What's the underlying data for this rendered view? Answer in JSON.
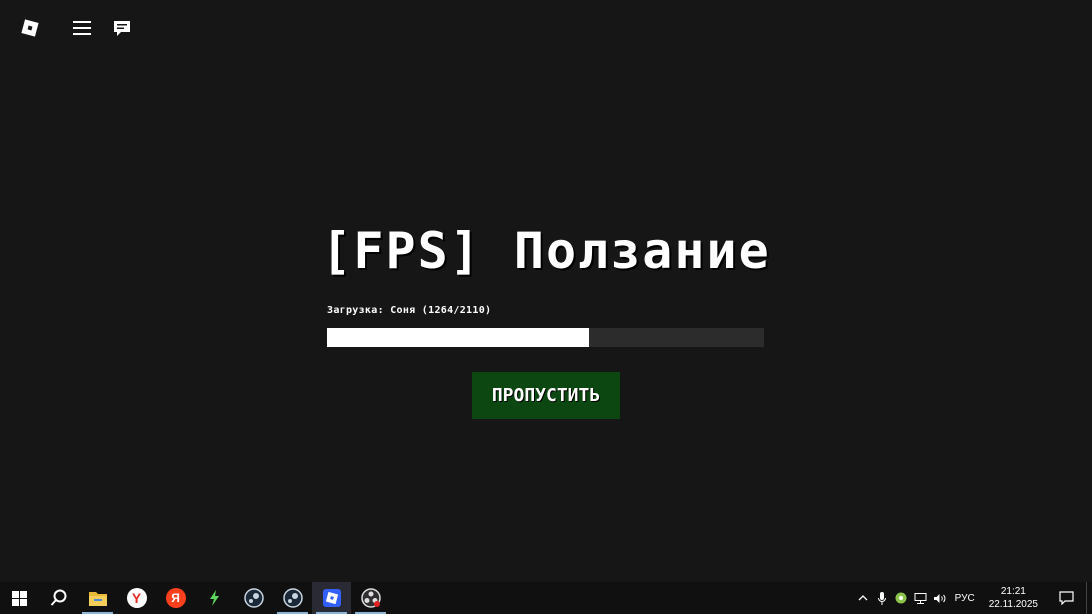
{
  "game": {
    "title": "[FPS] Ползание",
    "loading_text": "Загрузка: Соня (1264/2110)",
    "progress": 0.6,
    "skip_label": "ПРОПУСТИТЬ"
  },
  "top_controls": [
    {
      "name": "roblox-logo-button",
      "icon": "roblox-logo-icon"
    },
    {
      "name": "menu-button",
      "icon": "hamburger-menu-icon"
    },
    {
      "name": "chat-button",
      "icon": "chat-icon"
    }
  ],
  "taskbar": {
    "apps": [
      {
        "name": "start-button",
        "icon": "windows-logo-icon"
      },
      {
        "name": "search-button",
        "icon": "search-icon"
      },
      {
        "name": "file-explorer",
        "icon": "folder-icon"
      },
      {
        "name": "yandex-browser",
        "icon": "yandex-browser-icon"
      },
      {
        "name": "yandex",
        "icon": "yandex-icon"
      },
      {
        "name": "green-app",
        "icon": "lightning-icon"
      },
      {
        "name": "steam-1",
        "icon": "steam-icon"
      },
      {
        "name": "steam-2",
        "icon": "steam-icon"
      },
      {
        "name": "roblox",
        "icon": "roblox-icon"
      },
      {
        "name": "obs",
        "icon": "obs-icon"
      }
    ],
    "tray": {
      "language": "РУС",
      "time": "21:21",
      "date": "22.11.2025"
    }
  },
  "colors": {
    "background": "#161616",
    "progress_fill": "#ffffff",
    "progress_track": "#2c2c2c",
    "skip_button": "#0c4711",
    "taskbar": "#101010"
  }
}
